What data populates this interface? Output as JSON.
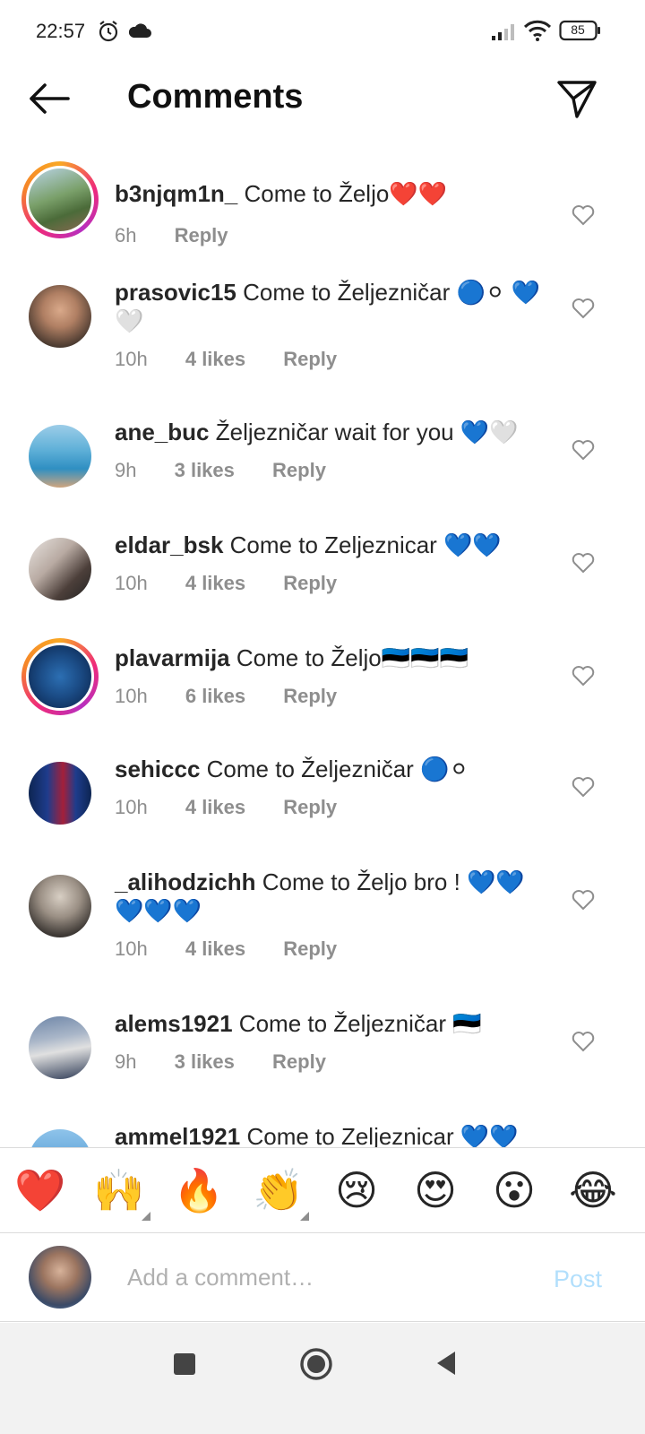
{
  "status_bar": {
    "time": "22:57",
    "battery": "85",
    "icons": [
      "alarm-icon",
      "cloud-icon",
      "signal-icon",
      "wifi-icon",
      "battery-icon"
    ]
  },
  "header": {
    "title": "Comments",
    "back_icon": "arrow-left-icon",
    "send_icon": "paper-plane-icon"
  },
  "comments": [
    {
      "username": "b3njqm1n_",
      "text": "Come to Željo❤️❤️",
      "time": "6h",
      "likes": "",
      "reply": "Reply"
    },
    {
      "username": "prasovic15",
      "text": "Come to Željezničar 🔵⚪ 💙🤍",
      "time": "10h",
      "likes": "4 likes",
      "reply": "Reply"
    },
    {
      "username": "ane_buc",
      "text": "Željezničar wait for you 💙🤍",
      "time": "9h",
      "likes": "3 likes",
      "reply": "Reply"
    },
    {
      "username": "eldar_bsk",
      "text": "Come to Zeljeznicar 💙💙",
      "time": "10h",
      "likes": "4 likes",
      "reply": "Reply"
    },
    {
      "username": "plavarmija",
      "text": "Come to Željo🇪🇪🇪🇪🇪🇪",
      "time": "10h",
      "likes": "6 likes",
      "reply": "Reply"
    },
    {
      "username": "sehiccc",
      "text": "Come to Željezničar 🔵⚪",
      "time": "10h",
      "likes": "4 likes",
      "reply": "Reply"
    },
    {
      "username": "_alihodzichh",
      "text": "Come to Željo bro ! 💙💙 💙💙💙",
      "time": "10h",
      "likes": "4 likes",
      "reply": "Reply"
    },
    {
      "username": "alems1921",
      "text": "Come to Željezničar 🇪🇪",
      "time": "9h",
      "likes": "3 likes",
      "reply": "Reply"
    },
    {
      "username": "ammel1921",
      "text": "Come to Zeljeznicar 💙💙",
      "time": "",
      "likes": "",
      "reply": ""
    }
  ],
  "reactions": [
    "❤️",
    "🙌",
    "🔥",
    "👏",
    "😢",
    "😍",
    "😮",
    "😂"
  ],
  "compose": {
    "placeholder": "Add a comment…",
    "post_label": "Post"
  },
  "nav": {
    "icons": [
      "recents-square-icon",
      "home-circle-icon",
      "back-triangle-icon"
    ]
  },
  "colors": {
    "text": "#262626",
    "meta": "#8e8e8e",
    "post_disabled": "#b2dffc",
    "heart": "#e0245e"
  }
}
